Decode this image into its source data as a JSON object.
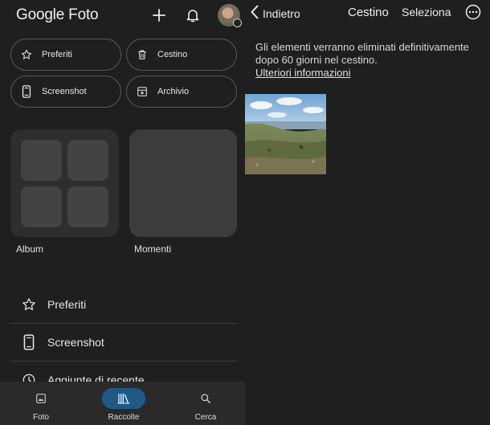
{
  "left": {
    "logo": {
      "brand": "Google",
      "product": "Foto"
    },
    "header_icons": [
      "plus-icon",
      "bell-icon",
      "avatar"
    ],
    "chips": [
      {
        "label": "Preferiti",
        "icon": "star-icon"
      },
      {
        "label": "Cestino",
        "icon": "trash-icon"
      },
      {
        "label": "Screenshot",
        "icon": "phone-icon"
      },
      {
        "label": "Archivio",
        "icon": "archive-icon"
      }
    ],
    "tiles": [
      {
        "label": "Album"
      },
      {
        "label": "Momenti"
      }
    ],
    "list": [
      {
        "label": "Preferiti",
        "icon": "star-icon"
      },
      {
        "label": "Screenshot",
        "icon": "phone-icon"
      },
      {
        "label": "Aggiunte di recente",
        "icon": "clock-icon"
      }
    ],
    "bottom_nav": [
      {
        "label": "Foto",
        "icon": "photo-icon",
        "active": false
      },
      {
        "label": "Raccolte",
        "icon": "library-icon",
        "active": true
      },
      {
        "label": "Cerca",
        "icon": "search-icon",
        "active": false
      }
    ]
  },
  "right": {
    "back_label": "Indietro",
    "title": "Cestino",
    "select_label": "Seleziona",
    "message": "Gli elementi verranno eliminati definitivamente dopo 60 giorni nel cestino.",
    "link": "Ulteriori informazioni"
  },
  "colors": {
    "background": "#1f1f1f",
    "nav_background": "#2a2a2a",
    "active_pill": "#1f5a85",
    "chip_border": "#5a5a5a"
  }
}
